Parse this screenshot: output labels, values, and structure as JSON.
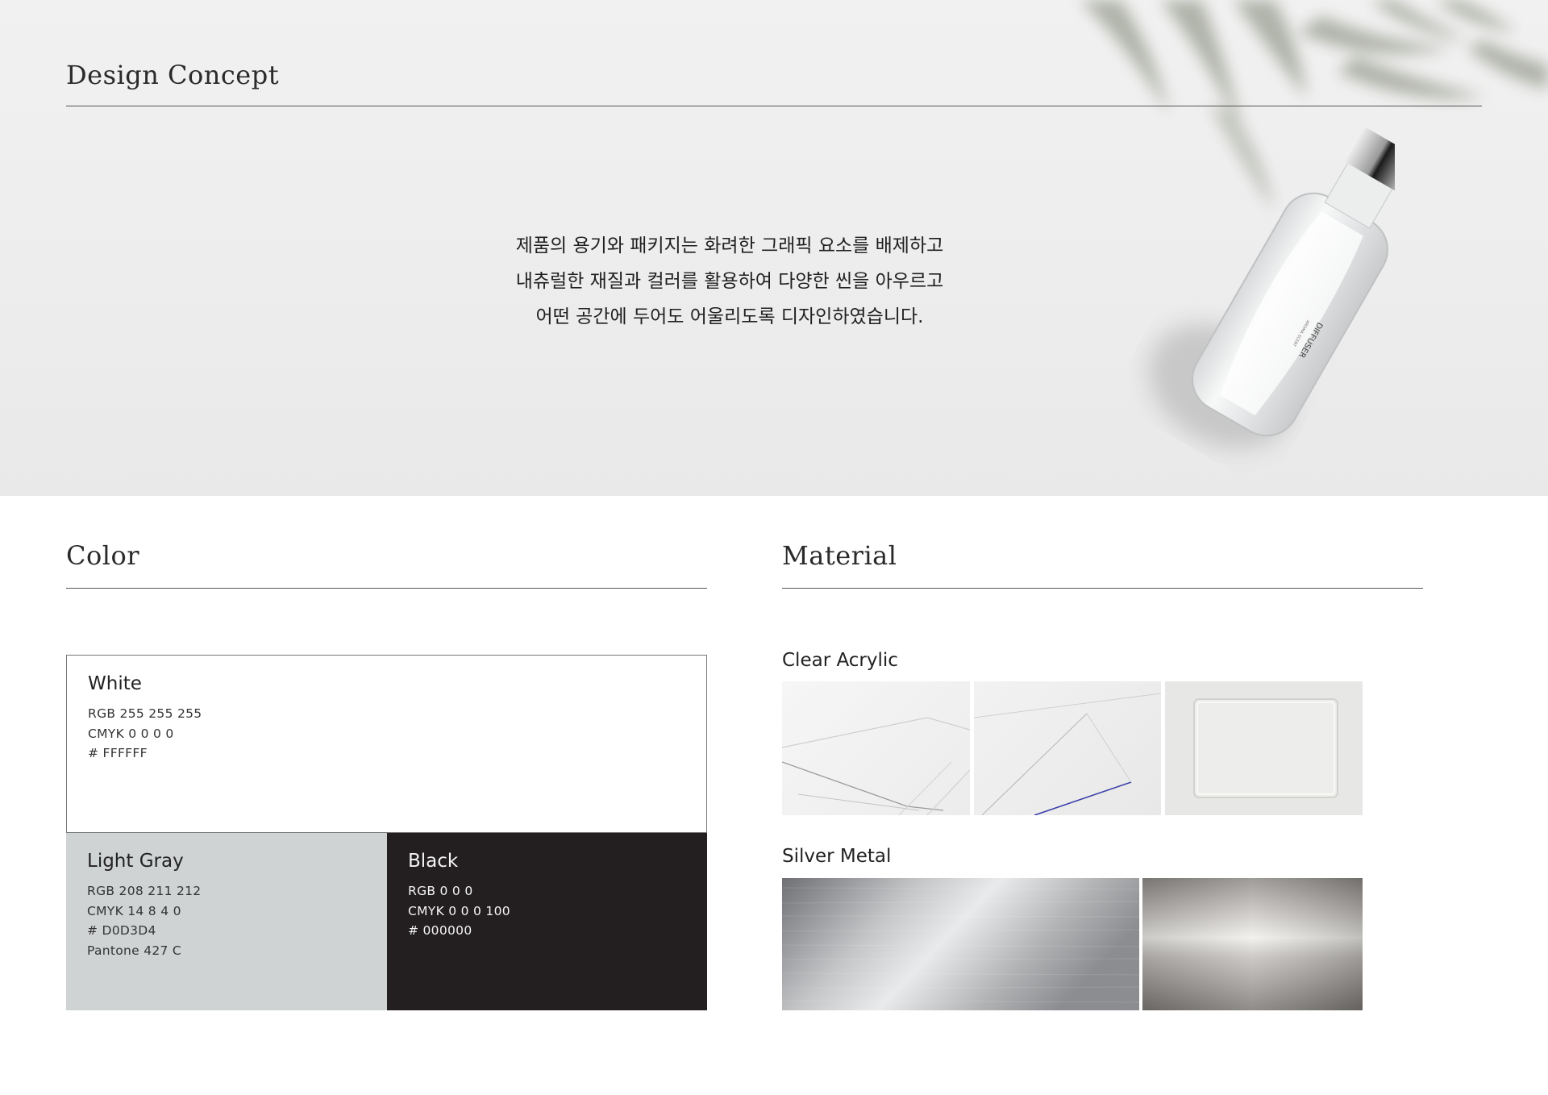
{
  "hero": {
    "title": "Design Concept",
    "concept_lines": [
      "제품의 용기와 패키지는 화려한 그래픽 요소를 배제하고",
      "내츄럴한 재질과 컬러를 활용하여 다양한 씬을 아우르고",
      "어떤 공간에 두어도 어울리도록 디자인하였습니다."
    ],
    "bottle_label": "DIFFUSER",
    "bottle_sublabel": "AROMA SCENT"
  },
  "color_section": {
    "title": "Color",
    "swatches": [
      {
        "name": "White",
        "hex": "#FFFFFF",
        "lines": [
          "RGB  255 255 255",
          "CMYK  0 0 0 0",
          "# FFFFFF"
        ]
      },
      {
        "name": "Light Gray",
        "hex": "#D0D3D4",
        "lines": [
          "RGB  208 211 212",
          "CMYK  14 8 4 0",
          "# D0D3D4",
          "Pantone 427 C"
        ]
      },
      {
        "name": "Black",
        "hex": "#000000",
        "lines": [
          "RGB  0 0 0",
          "CMYK  0 0 0 100",
          "# 000000"
        ]
      }
    ]
  },
  "material_section": {
    "title": "Material",
    "groups": [
      {
        "name": "Clear Acrylic",
        "images": [
          "acrylic-sheets-image",
          "acrylic-sheets-edge-image",
          "acrylic-block-image"
        ]
      },
      {
        "name": "Silver Metal",
        "images": [
          "brushed-metal-image",
          "polished-metal-image"
        ]
      }
    ]
  }
}
